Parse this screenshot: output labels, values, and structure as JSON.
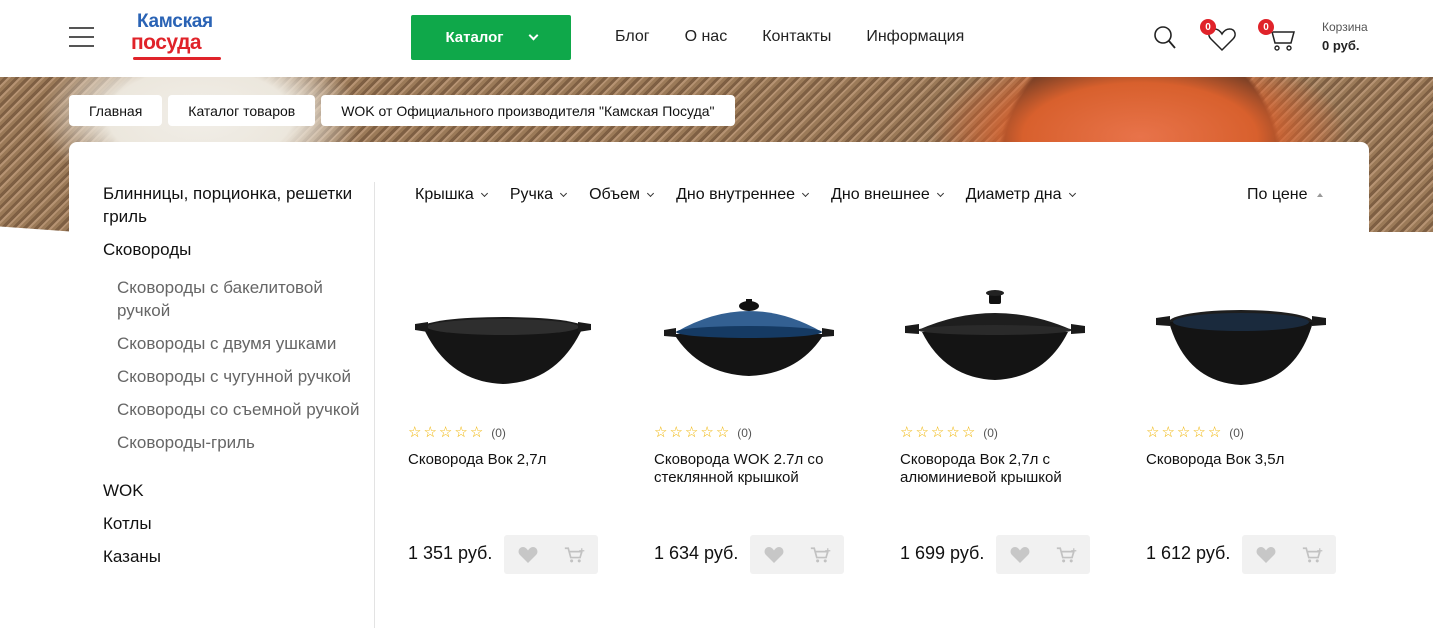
{
  "header": {
    "logo_top": "Камская",
    "logo_bottom": "посуда",
    "catalog_label": "Каталог",
    "nav": [
      "Блог",
      "О нас",
      "Контакты",
      "Информация"
    ],
    "favorites_count": "0",
    "cart_count": "0",
    "cart_title": "Корзина",
    "cart_sum": "0 руб."
  },
  "breadcrumbs": [
    "Главная",
    "Каталог товаров",
    "WOK от Официального производителя \"Камская Посуда\""
  ],
  "sidebar": {
    "items": [
      {
        "label": "Блинницы, порционка, решетки гриль",
        "level": 0
      },
      {
        "label": "Сковороды",
        "level": 0
      },
      {
        "label": "Сковороды с бакелитовой ручкой",
        "level": 1
      },
      {
        "label": "Сковороды с двумя ушками",
        "level": 1
      },
      {
        "label": "Сковороды с чугунной ручкой",
        "level": 1
      },
      {
        "label": "Сковороды со съемной ручкой",
        "level": 1
      },
      {
        "label": "Сковороды-гриль",
        "level": 1
      },
      {
        "label": "WOK",
        "level": 0
      },
      {
        "label": "Котлы",
        "level": 0
      },
      {
        "label": "Казаны",
        "level": 0
      }
    ]
  },
  "filters": [
    "Крышка",
    "Ручка",
    "Объем",
    "Дно внутреннее",
    "Дно внешнее",
    "Диаметр дна"
  ],
  "sort_label": "По цене",
  "products": [
    {
      "name": "Сковорода Вок 2,7л",
      "price": "1 351 руб.",
      "reviews": "(0)",
      "rating": 0,
      "image": "wok-plain-icon"
    },
    {
      "name": "Сковорода WOK 2.7л со стеклянной крышкой",
      "price": "1 634 руб.",
      "reviews": "(0)",
      "rating": 0,
      "image": "wok-glass-lid-icon"
    },
    {
      "name": "Сковорода Вок 2,7л с алюминиевой крышкой",
      "price": "1 699 руб.",
      "reviews": "(0)",
      "rating": 0,
      "image": "wok-metal-lid-icon"
    },
    {
      "name": "Сковорода Вок 3,5л",
      "price": "1 612 руб.",
      "reviews": "(0)",
      "rating": 0,
      "image": "wok-deep-icon"
    }
  ],
  "colors": {
    "accent_green": "#0fa84a",
    "brand_red": "#e0232a",
    "brand_blue": "#2a63b5",
    "star": "#f0b400"
  }
}
